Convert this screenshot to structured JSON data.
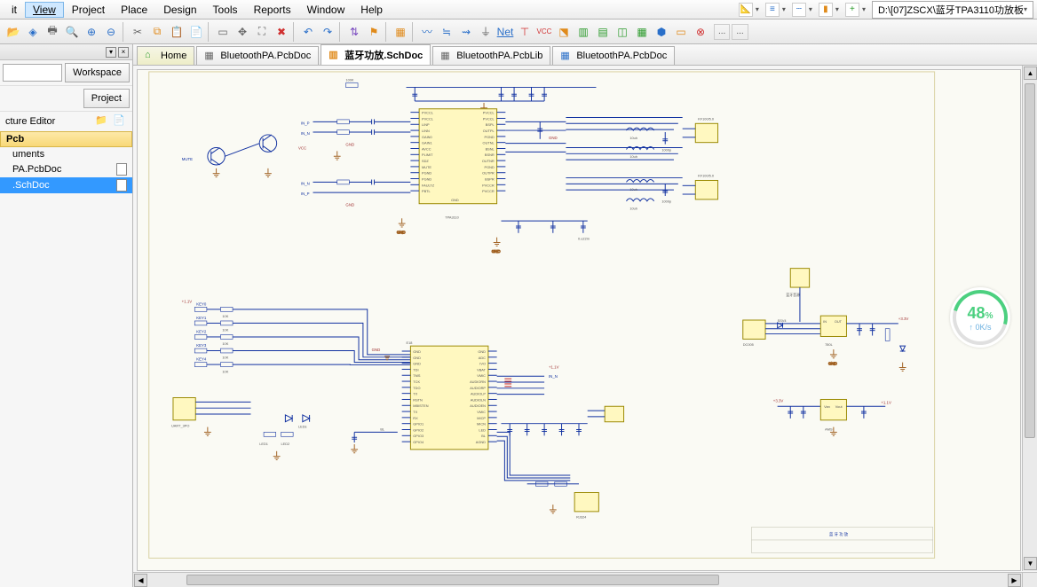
{
  "menubar": {
    "items": [
      "it",
      "View",
      "Project",
      "Place",
      "Design",
      "Tools",
      "Reports",
      "Window",
      "Help"
    ],
    "path": "D:\\[07]ZSCX\\蓝牙TPA3110功放板"
  },
  "toolbar": {
    "dots1": "...",
    "dots2": "..."
  },
  "doc_tabs": {
    "home": "Home",
    "t1": "BluetoothPA.PcbDoc",
    "t2": "蓝牙功放.SchDoc",
    "t3": "BluetoothPA.PcbLib",
    "t4": "BluetoothPA.PcbDoc"
  },
  "left_panel": {
    "workspace_btn": "Workspace",
    "project_btn": "Project",
    "editor_label": "cture Editor",
    "tree_head": "Pcb",
    "tree_group": "uments",
    "tree_items": [
      "PA.PcbDoc",
      ".SchDoc"
    ]
  },
  "schematic": {
    "ic_top": "TPA3110",
    "ic_top_pins_left": [
      "PVCCL",
      "PVCCL",
      "LINP",
      "LINN",
      "GAIN0",
      "GAIN1",
      "AVCC",
      "PLIMIT",
      "SDZ",
      "MUTE",
      "PGND",
      "PGND",
      "FAULTZ",
      "PBTL"
    ],
    "ic_top_pins_right": [
      "PVCCL",
      "PVCCL",
      "BSPL",
      "OUTPL",
      "PGND",
      "OUTNL",
      "BSNL",
      "BSNR",
      "OUTNR",
      "PGND",
      "OUTPR",
      "BSPR",
      "PVCCR",
      "PVCCR"
    ],
    "ic_top_bottom": "GND",
    "ic_bot_pins_left": [
      "GND",
      "GND",
      "GND",
      "TDI",
      "TMS",
      "TCK",
      "TDO",
      "TX",
      "RSTN",
      "MBISTEN",
      "TX",
      "RX",
      "GPIO1",
      "GPIO2",
      "GPIO3",
      "GPIO4"
    ],
    "ic_bot_pins_right": [
      "GND",
      "ADC",
      "IVO",
      "VBAT",
      "VMIC",
      "AUDIORN",
      "AUDIORP",
      "AUDIOLP",
      "AUDIOLN",
      "AUDIOEN",
      "VMIC",
      "MICP",
      "MICN",
      "LED",
      "BL",
      "AGND"
    ],
    "labels": {
      "vcc": "VCC",
      "gnd": "GND",
      "mute": "MUTE",
      "in_p": "IN_P",
      "in_n": "IN_N",
      "r_100k": "100K",
      "r_10k": "10K",
      "c_0u22m": "0.u22m",
      "c_10uh": "10uh",
      "c_1000p": "1000p",
      "conn_kf": "KF100/5.0",
      "key0": "KEY0",
      "key1": "KEY1",
      "key2": "KEY2",
      "key3": "KEY3",
      "key4": "KEY4",
      "uart": "UART_3PO",
      "dc": "DC005",
      "ssv": "SSV4",
      "reg": "780L",
      "ams": "AMS",
      "rj": "RJ324",
      "p1v": "+1.1V",
      "p3v": "+3.3V",
      "title": "蓝 牙 功 放",
      "e18": "E18",
      "leds": "LEDs",
      "bl": "BL",
      "led1": "LED1",
      "led2": "LED2",
      "in_lbl": "IN",
      "out_lbl": "OUT",
      "vin": "Van",
      "vout": "Vout",
      "earphone": "蓝牙音源"
    }
  },
  "perf": {
    "pct": "48",
    "pct_suffix": "%",
    "rate": "↑ 0K/s"
  }
}
